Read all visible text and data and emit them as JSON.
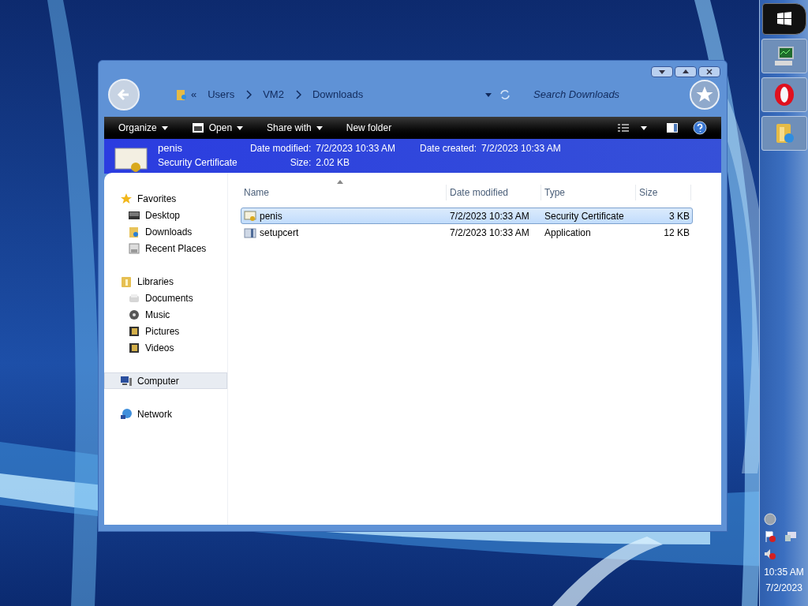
{
  "window": {
    "breadcrumb": [
      "Users",
      "VM2",
      "Downloads"
    ],
    "overflow": "«",
    "search": {
      "placeholder": "Search Downloads"
    }
  },
  "toolbar": [
    {
      "label": "Organize",
      "dropdown": true,
      "kind": "plain"
    },
    {
      "label": "Open",
      "dropdown": true,
      "kind": "open"
    },
    {
      "label": "Share with",
      "dropdown": true,
      "kind": "plain"
    },
    {
      "label": "New folder",
      "dropdown": false,
      "kind": "plain"
    }
  ],
  "details": {
    "name": "penis",
    "type": "Security Certificate",
    "fields": [
      {
        "label": "Date modified:",
        "value": "7/2/2023 10:33 AM"
      },
      {
        "label": "Date created:",
        "value": "7/2/2023 10:33 AM"
      },
      {
        "label": "Size:",
        "value": "2.02 KB"
      }
    ]
  },
  "nav": [
    {
      "label": "Favorites",
      "kind": "star",
      "selected": false,
      "children": [
        {
          "label": "Desktop",
          "kind": "desktop",
          "selected": false
        },
        {
          "label": "Downloads",
          "kind": "downloads",
          "selected": false
        },
        {
          "label": "Recent Places",
          "kind": "recent",
          "selected": false
        }
      ]
    },
    {
      "label": "Libraries",
      "kind": "library",
      "selected": false,
      "children": [
        {
          "label": "Documents",
          "kind": "documents",
          "selected": false
        },
        {
          "label": "Music",
          "kind": "music",
          "selected": false
        },
        {
          "label": "Pictures",
          "kind": "pictures",
          "selected": false
        },
        {
          "label": "Videos",
          "kind": "pictures",
          "selected": false
        }
      ]
    },
    {
      "label": "Computer",
      "kind": "computer",
      "selected": true
    },
    {
      "label": "Network",
      "kind": "network",
      "selected": false
    }
  ],
  "table": {
    "columns": [
      "Name",
      "Date modified",
      "Type",
      "Size"
    ],
    "rows": [
      {
        "name": "penis",
        "kind": "certificate",
        "date": "7/2/2023 10:33 AM",
        "type": "Security Certificate",
        "size": "3 KB",
        "selected": true
      },
      {
        "name": "setupcert",
        "kind": "application",
        "date": "7/2/2023 10:33 AM",
        "type": "Application",
        "size": "12 KB",
        "selected": false
      }
    ]
  },
  "taskbar": {
    "items": [
      {
        "kind": "monitor"
      },
      {
        "kind": "opera"
      },
      {
        "kind": "explorer"
      }
    ],
    "time": "10:35 AM",
    "date": "7/2/2023"
  }
}
